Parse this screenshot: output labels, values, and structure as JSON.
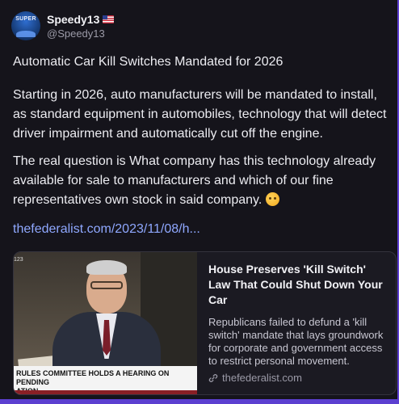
{
  "author": {
    "display_name": "Speedy13",
    "handle": "@Speedy13",
    "flag_icon": "us-flag-icon",
    "avatar_text": "SUPER"
  },
  "post": {
    "title": "Automatic Car Kill Switches Mandated for 2026",
    "paragraph1": "Starting in 2026, auto manufacturers will be mandated to install, as standard equipment in automobiles, technology that will detect driver impairment and automatically cut off the engine.",
    "paragraph2": "The real question is What company has this technology already available for sale to manufacturers and which of our fine representatives own stock in said company.",
    "paragraph2_emoji": "thinking-face-emoji",
    "link_text": "thefederalist.com/2023/11/08/h..."
  },
  "link_card": {
    "image_corner_text": "123",
    "image_caption_line1": "RULES COMMITTEE HOLDS A HEARING ON PENDING",
    "image_caption_line2": "ATION",
    "title": "House Preserves 'Kill Switch' Law That Could Shut Down Your Car",
    "description": "Republicans failed to defund a 'kill switch' mandate that lays groundwork for corporate and government access to restrict personal movement.",
    "domain": "thefederalist.com",
    "domain_icon": "link-icon"
  },
  "colors": {
    "background": "#15141b",
    "accent_border": "#5c3fd0",
    "link": "#8fa8ff"
  }
}
